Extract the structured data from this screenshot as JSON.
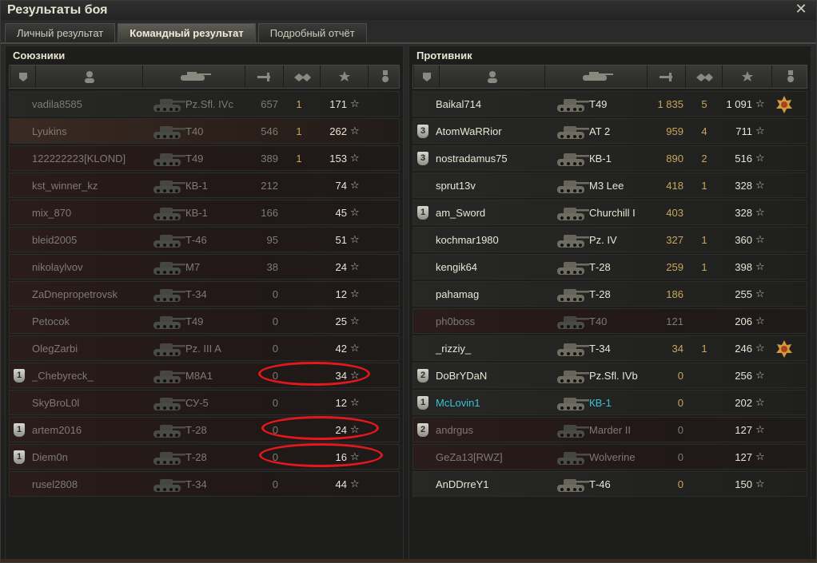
{
  "window": {
    "title": "Результаты боя",
    "close_icon": "close-icon"
  },
  "tabs": [
    {
      "label": "Личный результат",
      "active": false
    },
    {
      "label": "Командный результат",
      "active": true
    },
    {
      "label": "Подробный отчёт",
      "active": false
    }
  ],
  "allies": {
    "title": "Союзники",
    "rows": [
      {
        "badge": "",
        "player": "vadila8585",
        "tank": "Pz.Sfl. IVc",
        "damage": "657",
        "kills": "1",
        "xp": "171",
        "style": "dim",
        "row": "normal"
      },
      {
        "badge": "",
        "player": "Lyukins",
        "tank": "T40",
        "damage": "546",
        "kills": "1",
        "xp": "262",
        "style": "dim",
        "row": "own"
      },
      {
        "badge": "",
        "player": "122222223[KLOND]",
        "tank": "T49",
        "damage": "389",
        "kills": "1",
        "xp": "153",
        "style": "dim",
        "row": "dark"
      },
      {
        "badge": "",
        "player": "kst_winner_kz",
        "tank": "КВ-1",
        "damage": "212",
        "kills": "",
        "xp": "74",
        "style": "dim",
        "row": "dark"
      },
      {
        "badge": "",
        "player": "mix_870",
        "tank": "КВ-1",
        "damage": "166",
        "kills": "",
        "xp": "45",
        "style": "dim",
        "row": "dark"
      },
      {
        "badge": "",
        "player": "bleid2005",
        "tank": "Т-46",
        "damage": "95",
        "kills": "",
        "xp": "51",
        "style": "dim",
        "row": "dark"
      },
      {
        "badge": "",
        "player": "nikolaylvov",
        "tank": "M7",
        "damage": "38",
        "kills": "",
        "xp": "24",
        "style": "dim",
        "row": "dark"
      },
      {
        "badge": "",
        "player": "ZaDnepropetrovsk",
        "tank": "Т-34",
        "damage": "0",
        "kills": "",
        "xp": "12",
        "style": "dim",
        "row": "dark"
      },
      {
        "badge": "",
        "player": "Petocok",
        "tank": "T49",
        "damage": "0",
        "kills": "",
        "xp": "25",
        "style": "dim",
        "row": "dark"
      },
      {
        "badge": "",
        "player": "OlegZarbi",
        "tank": "Pz. III A",
        "damage": "0",
        "kills": "",
        "xp": "42",
        "style": "dim",
        "row": "dark"
      },
      {
        "badge": "1",
        "player": "_Chebyreck_",
        "tank": "M8A1",
        "damage": "0",
        "kills": "",
        "xp": "34",
        "style": "dim",
        "row": "dark"
      },
      {
        "badge": "",
        "player": "SkyBroL0l",
        "tank": "СУ-5",
        "damage": "0",
        "kills": "",
        "xp": "12",
        "style": "dim",
        "row": "dark"
      },
      {
        "badge": "1",
        "player": "artem2016",
        "tank": "Т-28",
        "damage": "0",
        "kills": "",
        "xp": "24",
        "style": "dim",
        "row": "dark"
      },
      {
        "badge": "1",
        "player": "Diem0n",
        "tank": "Т-28",
        "damage": "0",
        "kills": "",
        "xp": "16",
        "style": "dim",
        "row": "dark"
      },
      {
        "badge": "",
        "player": "rusel2808",
        "tank": "Т-34",
        "damage": "0",
        "kills": "",
        "xp": "44",
        "style": "dim",
        "row": "dark"
      }
    ]
  },
  "enemies": {
    "title": "Противник",
    "rows": [
      {
        "badge": "",
        "player": "Baikal714",
        "tank": "T49",
        "damage": "1 835",
        "kills": "5",
        "xp": "1 091",
        "style": "bright",
        "medal": true
      },
      {
        "badge": "3",
        "player": "AtomWaRRior",
        "tank": "AT 2",
        "damage": "959",
        "kills": "4",
        "xp": "711",
        "style": "bright"
      },
      {
        "badge": "3",
        "player": "nostradamus75",
        "tank": "КВ-1",
        "damage": "890",
        "kills": "2",
        "xp": "516",
        "style": "bright"
      },
      {
        "badge": "",
        "player": "sprut13v",
        "tank": "M3 Lee",
        "damage": "418",
        "kills": "1",
        "xp": "328",
        "style": "bright"
      },
      {
        "badge": "1",
        "player": "am_Sword",
        "tank": "Churchill I",
        "damage": "403",
        "kills": "",
        "xp": "328",
        "style": "bright"
      },
      {
        "badge": "",
        "player": "kochmar1980",
        "tank": "Pz. IV",
        "damage": "327",
        "kills": "1",
        "xp": "360",
        "style": "bright"
      },
      {
        "badge": "",
        "player": "kengik64",
        "tank": "Т-28",
        "damage": "259",
        "kills": "1",
        "xp": "398",
        "style": "bright"
      },
      {
        "badge": "",
        "player": "pahamag",
        "tank": "Т-28",
        "damage": "186",
        "kills": "",
        "xp": "255",
        "style": "bright"
      },
      {
        "badge": "",
        "player": "ph0boss",
        "tank": "T40",
        "damage": "121",
        "kills": "",
        "xp": "206",
        "style": "dim",
        "row": "dark"
      },
      {
        "badge": "",
        "player": "_rizziy_",
        "tank": "Т-34",
        "damage": "34",
        "kills": "1",
        "xp": "246",
        "style": "bright",
        "medal": true
      },
      {
        "badge": "2",
        "player": "DoBrYDaN",
        "tank": "Pz.Sfl. IVb",
        "damage": "0",
        "kills": "",
        "xp": "256",
        "style": "bright"
      },
      {
        "badge": "1",
        "player": "McLovin1",
        "tank": "КВ-1",
        "damage": "0",
        "kills": "",
        "xp": "202",
        "style": "cyan"
      },
      {
        "badge": "2",
        "player": "andrgus",
        "tank": "Marder II",
        "damage": "0",
        "kills": "",
        "xp": "127",
        "style": "dim",
        "row": "dark"
      },
      {
        "badge": "",
        "player": "GeZa13[RWZ]",
        "tank": "Wolverine",
        "damage": "0",
        "kills": "",
        "xp": "127",
        "style": "dim",
        "row": "dark"
      },
      {
        "badge": "",
        "player": "AnDDrreY1",
        "tank": "Т-46",
        "damage": "0",
        "kills": "",
        "xp": "150",
        "style": "bright"
      }
    ]
  },
  "colors": {
    "highlight_oval": "#e3181c",
    "accent_damage": "#c9a65b",
    "cyan_player": "#37c2d8"
  }
}
